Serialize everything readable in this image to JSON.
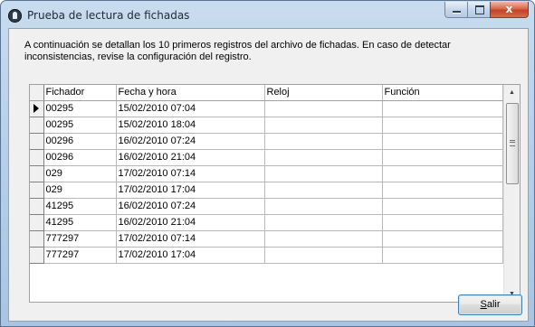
{
  "window": {
    "title": "Prueba de lectura de fichadas",
    "close_glyph": "x"
  },
  "description": "A continuación se detallan los 10 primeros registros del archivo de fichadas. En caso de detectar inconsistencias, revise la configuración del registro.",
  "grid": {
    "columns": [
      "Fichador",
      "Fecha y hora",
      "Reloj",
      "Función"
    ],
    "rows": [
      {
        "fichador": "00295",
        "fecha_hora": "15/02/2010 07:04",
        "reloj": "",
        "funcion": ""
      },
      {
        "fichador": "00295",
        "fecha_hora": "15/02/2010 18:04",
        "reloj": "",
        "funcion": ""
      },
      {
        "fichador": "00296",
        "fecha_hora": "16/02/2010 07:24",
        "reloj": "",
        "funcion": ""
      },
      {
        "fichador": "00296",
        "fecha_hora": "16/02/2010 21:04",
        "reloj": "",
        "funcion": ""
      },
      {
        "fichador": "029",
        "fecha_hora": "17/02/2010 07:14",
        "reloj": "",
        "funcion": ""
      },
      {
        "fichador": "029",
        "fecha_hora": "17/02/2010 17:04",
        "reloj": "",
        "funcion": ""
      },
      {
        "fichador": "41295",
        "fecha_hora": "16/02/2010 07:24",
        "reloj": "",
        "funcion": ""
      },
      {
        "fichador": "41295",
        "fecha_hora": "16/02/2010 21:04",
        "reloj": "",
        "funcion": ""
      },
      {
        "fichador": "777297",
        "fecha_hora": "17/02/2010 07:14",
        "reloj": "",
        "funcion": ""
      },
      {
        "fichador": "777297",
        "fecha_hora": "17/02/2010 17:04",
        "reloj": "",
        "funcion": ""
      }
    ],
    "selected_row": 0
  },
  "buttons": {
    "salir_mnemonic": "S",
    "salir_rest": "alir"
  },
  "colors": {
    "titlebar": "#b8d0ea",
    "close_button": "#c0442a",
    "dialog_background": "#f0f0f0",
    "focus_border": "#3c7fb1"
  },
  "icons": {
    "app": "app-globe-icon",
    "row_indicator": "row-pointer-icon",
    "scroll_up": "scroll-up-arrow-icon",
    "scroll_down": "scroll-down-arrow-icon"
  }
}
